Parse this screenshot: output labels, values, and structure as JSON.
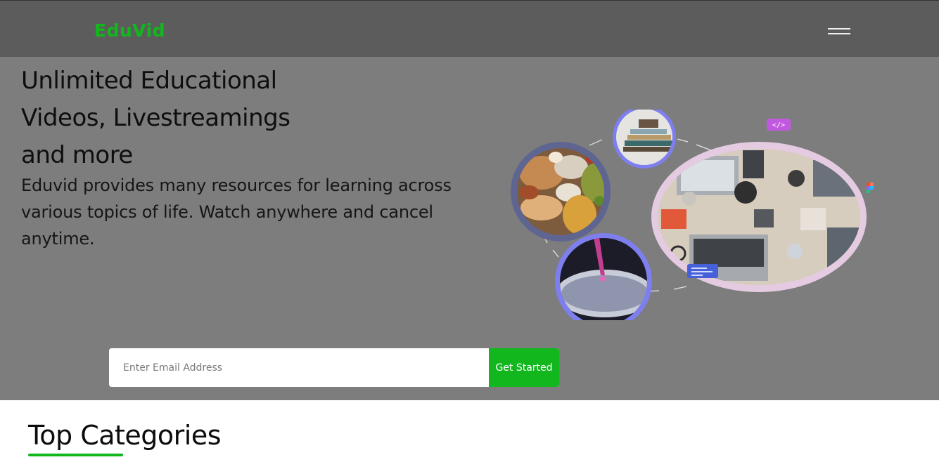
{
  "brand": {
    "name": "EduVid",
    "accent_color": "#12b71e"
  },
  "nav": {
    "menu_icon": "hamburger-menu-icon"
  },
  "hero": {
    "title_lines": [
      "Unlimited Educational",
      "Videos, Livestreamings",
      "and more"
    ],
    "description_lines": [
      "Eduvid provides many resources for learning across",
      "various topics of life. Watch anywhere and cancel",
      "anytime."
    ],
    "illustration": {
      "images": [
        "food-assortment-image",
        "books-stack-image",
        "lab-pipette-image",
        "workspace-desk-image"
      ],
      "badges": [
        "code-tag-badge",
        "figma-logo-badge",
        "code-snippet-badge"
      ],
      "code_badge_text": "</>"
    }
  },
  "signup": {
    "email_placeholder": "Enter Email Address",
    "email_value": "",
    "cta_label": "Get Started"
  },
  "categories": {
    "heading": "Top Categories"
  }
}
